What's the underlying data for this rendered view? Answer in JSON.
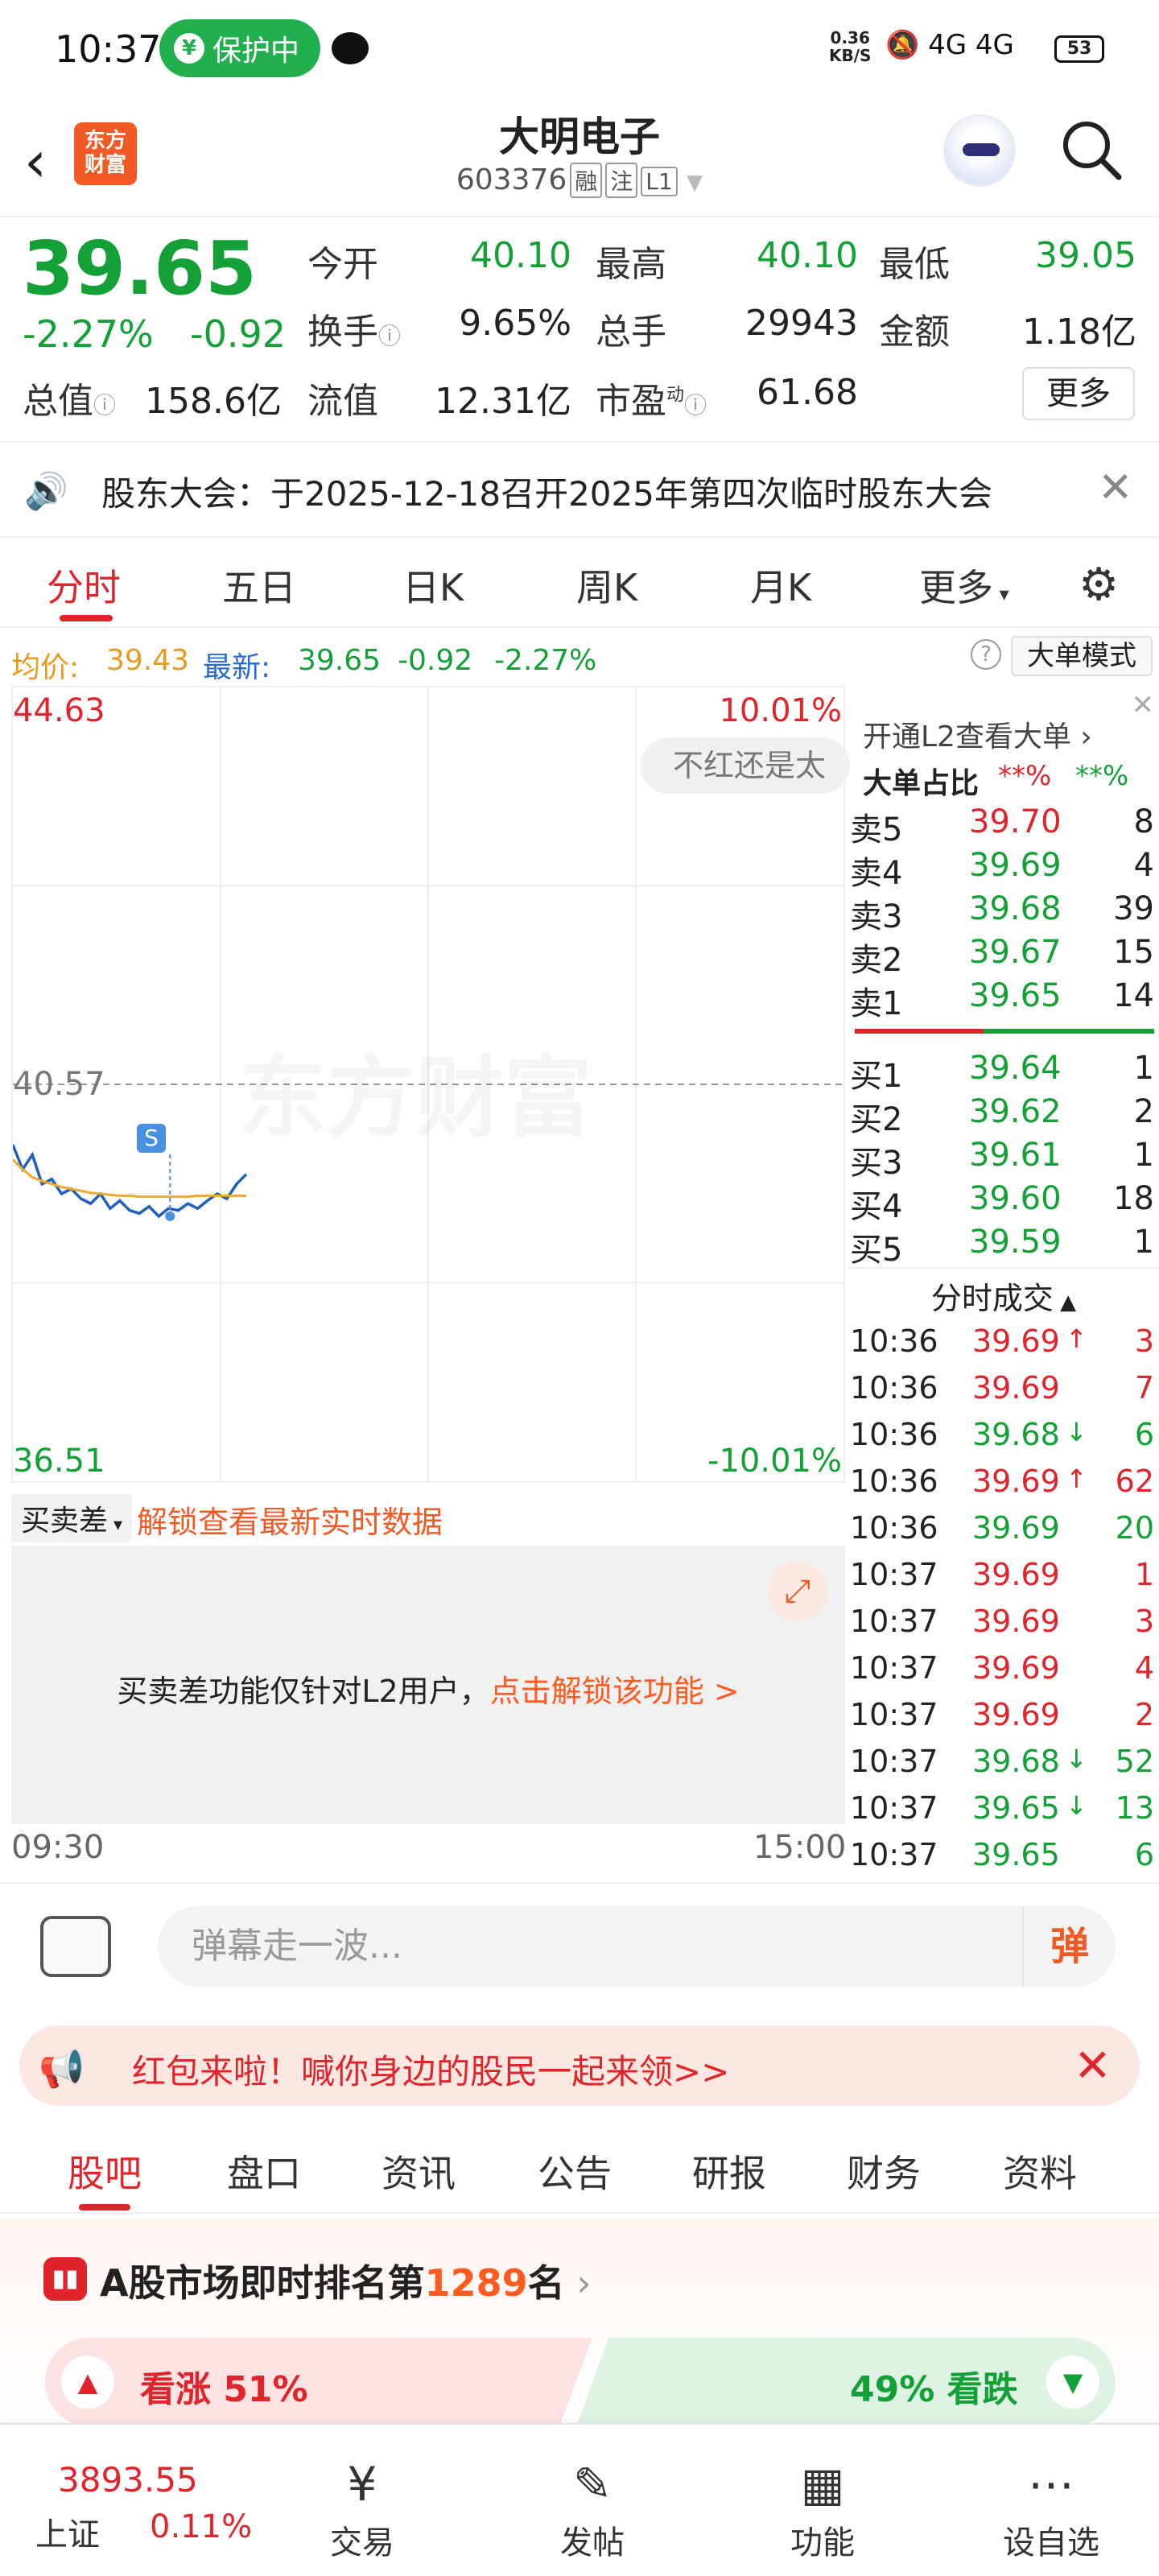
{
  "status": {
    "time": "10:37",
    "protect_label": "保护中",
    "net_speed_top": "0.36",
    "net_speed_bottom": "KB/S",
    "signal_icons": "🔕 4G 4G",
    "battery": "53"
  },
  "header": {
    "logo_line1": "东方",
    "logo_line2": "财富",
    "name": "大明电子",
    "code": "603376",
    "tags": [
      "融",
      "注",
      "L1"
    ]
  },
  "quote": {
    "price": "39.65",
    "change_pct": "-2.27%",
    "change_val": "-0.92",
    "fields": [
      {
        "label": "今开",
        "value": "40.10",
        "color": "green"
      },
      {
        "label": "最高",
        "value": "40.10",
        "color": "green"
      },
      {
        "label": "最低",
        "value": "39.05",
        "color": "green"
      },
      {
        "label": "换手",
        "value": "9.65%",
        "color": "black"
      },
      {
        "label": "总手",
        "value": "29943",
        "color": "black"
      },
      {
        "label": "金额",
        "value": "1.18亿",
        "color": "black"
      },
      {
        "label": "总值",
        "value": "158.6亿",
        "color": "black"
      },
      {
        "label": "流值",
        "value": "12.31亿",
        "color": "black"
      },
      {
        "label": "市盈",
        "value": "61.68",
        "color": "black"
      }
    ],
    "pe_superscript": "动",
    "more_label": "更多"
  },
  "notice": {
    "text": "股东大会：于2025-12-18召开2025年第四次临时股东大会"
  },
  "tabs": [
    "分时",
    "五日",
    "日K",
    "周K",
    "月K",
    "更多"
  ],
  "avgbar": {
    "avg_label": "均价:",
    "avg_value": "39.43",
    "latest_label": "最新:",
    "latest_value": "39.65",
    "latest_chg": "-0.92",
    "latest_pct": "-2.27%",
    "big_order_btn": "大单模式"
  },
  "chart": {
    "top_price": "44.63",
    "top_pct": "10.01%",
    "mid_price": "40.57",
    "bottom_price": "36.51",
    "bottom_pct": "-10.01%",
    "danmaku_bubble": "不红还是太",
    "watermark": "东方财富",
    "s_marker": "S",
    "time_start": "09:30",
    "time_end": "15:00"
  },
  "chart_data": {
    "type": "line",
    "ylim": [
      36.51,
      44.63
    ],
    "series": [
      {
        "values": [
          39.95,
          39.7,
          39.85,
          39.55,
          39.6,
          39.45,
          39.5,
          39.4,
          39.35,
          39.45,
          39.3,
          39.38,
          39.28,
          39.25,
          39.32,
          39.22,
          39.3,
          39.28,
          39.35,
          39.3,
          39.38,
          39.45,
          39.4,
          39.55,
          39.65
        ]
      },
      {
        "values": [
          39.8,
          39.7,
          39.62,
          39.58,
          39.55,
          39.52,
          39.5,
          39.48,
          39.46,
          39.45,
          39.44,
          39.43,
          39.43,
          39.42,
          39.42,
          39.42,
          39.42,
          39.42,
          39.42,
          39.43,
          39.43,
          39.43,
          39.43,
          39.43,
          39.43
        ]
      }
    ]
  },
  "l2": {
    "open_l2": "开通L2查看大单",
    "big_ratio_label": "大单占比",
    "big_ratio_a": "**%",
    "big_ratio_b": "**%",
    "asks": [
      {
        "label": "卖5",
        "price": "39.70",
        "vol": "8"
      },
      {
        "label": "卖4",
        "price": "39.69",
        "vol": "4"
      },
      {
        "label": "卖3",
        "price": "39.68",
        "vol": "39"
      },
      {
        "label": "卖2",
        "price": "39.67",
        "vol": "15"
      },
      {
        "label": "卖1",
        "price": "39.65",
        "vol": "14"
      }
    ],
    "bids": [
      {
        "label": "买1",
        "price": "39.64",
        "vol": "1"
      },
      {
        "label": "买2",
        "price": "39.62",
        "vol": "2"
      },
      {
        "label": "买3",
        "price": "39.61",
        "vol": "1"
      },
      {
        "label": "买4",
        "price": "39.60",
        "vol": "18"
      },
      {
        "label": "买5",
        "price": "39.59",
        "vol": "1"
      }
    ],
    "trades_title": "分时成交",
    "trades": [
      {
        "time": "10:36",
        "price": "39.69",
        "dir": "↑",
        "vol": "3",
        "color": "red"
      },
      {
        "time": "10:36",
        "price": "39.69",
        "dir": "",
        "vol": "7",
        "color": "red"
      },
      {
        "time": "10:36",
        "price": "39.68",
        "dir": "↓",
        "vol": "6",
        "color": "green"
      },
      {
        "time": "10:36",
        "price": "39.69",
        "dir": "↑",
        "vol": "62",
        "color": "red"
      },
      {
        "time": "10:36",
        "price": "39.69",
        "dir": "",
        "vol": "20",
        "color": "green"
      },
      {
        "time": "10:37",
        "price": "39.69",
        "dir": "",
        "vol": "1",
        "color": "red"
      },
      {
        "time": "10:37",
        "price": "39.69",
        "dir": "",
        "vol": "3",
        "color": "red"
      },
      {
        "time": "10:37",
        "price": "39.69",
        "dir": "",
        "vol": "4",
        "color": "red"
      },
      {
        "time": "10:37",
        "price": "39.69",
        "dir": "",
        "vol": "2",
        "color": "red"
      },
      {
        "time": "10:37",
        "price": "39.68",
        "dir": "↓",
        "vol": "52",
        "color": "green"
      },
      {
        "time": "10:37",
        "price": "39.65",
        "dir": "↓",
        "vol": "13",
        "color": "green"
      },
      {
        "time": "10:37",
        "price": "39.65",
        "dir": "",
        "vol": "6",
        "color": "green"
      }
    ]
  },
  "spread": {
    "label": "买卖差",
    "unlock": "解锁查看最新实时数据",
    "msg_prefix": "买卖差功能仅针对L2用户，",
    "msg_link": "点击解锁该功能 >"
  },
  "danmaku": {
    "placeholder": "弹幕走一波...",
    "send": "弹"
  },
  "packet": {
    "text": "红包来啦！喊你身边的股民一起来领>>"
  },
  "subtabs": [
    "股吧",
    "盘口",
    "资讯",
    "公告",
    "研报",
    "财务",
    "资料"
  ],
  "ranking": {
    "prefix": "A股市场即时排名第",
    "rank": "1289",
    "suffix": "名",
    "up": "看涨 51%",
    "down": "49% 看跌"
  },
  "bottomnav": {
    "index_value": "3893.55",
    "index_name": "上证",
    "index_pct": "0.11%",
    "items": [
      "交易",
      "发帖",
      "功能",
      "设自选"
    ]
  },
  "colors": {
    "up": "#e0242b",
    "down": "#13a036",
    "accent": "#f15a24"
  }
}
